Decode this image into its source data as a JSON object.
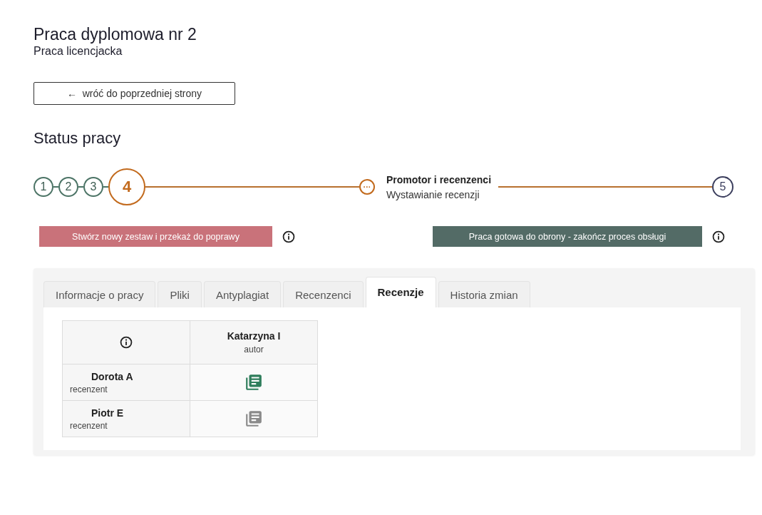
{
  "header": {
    "title": "Praca dyplomowa nr 2",
    "subtitle": "Praca licencjacka"
  },
  "back_button": {
    "arrow": "←",
    "label": "wróć do poprzedniej strony"
  },
  "status": {
    "heading": "Status pracy",
    "steps": [
      {
        "label": "1",
        "kind": "done"
      },
      {
        "label": "2",
        "kind": "done"
      },
      {
        "label": "3",
        "kind": "done"
      },
      {
        "label": "4",
        "kind": "current"
      },
      {
        "label": "5",
        "kind": "todo"
      }
    ],
    "substep": {
      "icon": "···",
      "title": "Promotor i recenzenci",
      "subtitle": "Wystawianie recenzji"
    }
  },
  "actions": [
    {
      "label": "Stwórz nowy zestaw i przekaż do poprawy",
      "kind": "danger"
    },
    {
      "label": "Praca gotowa do obrony - zakończ proces obsługi",
      "kind": "confirm"
    }
  ],
  "tabs": [
    {
      "label": "Informacje o pracy",
      "selected": false
    },
    {
      "label": "Pliki",
      "selected": false
    },
    {
      "label": "Antyplagiat",
      "selected": false
    },
    {
      "label": "Recenzenci",
      "selected": false
    },
    {
      "label": "Recenzje",
      "selected": true
    },
    {
      "label": "Historia zmian",
      "selected": false
    }
  ],
  "table": {
    "author": {
      "name": "Katarzyna I",
      "role": "autor"
    },
    "rows": [
      {
        "name": "Dorota A",
        "role": "recenzent",
        "active": true
      },
      {
        "name": "Piotr E",
        "role": "recenzent",
        "active": false
      }
    ]
  }
}
